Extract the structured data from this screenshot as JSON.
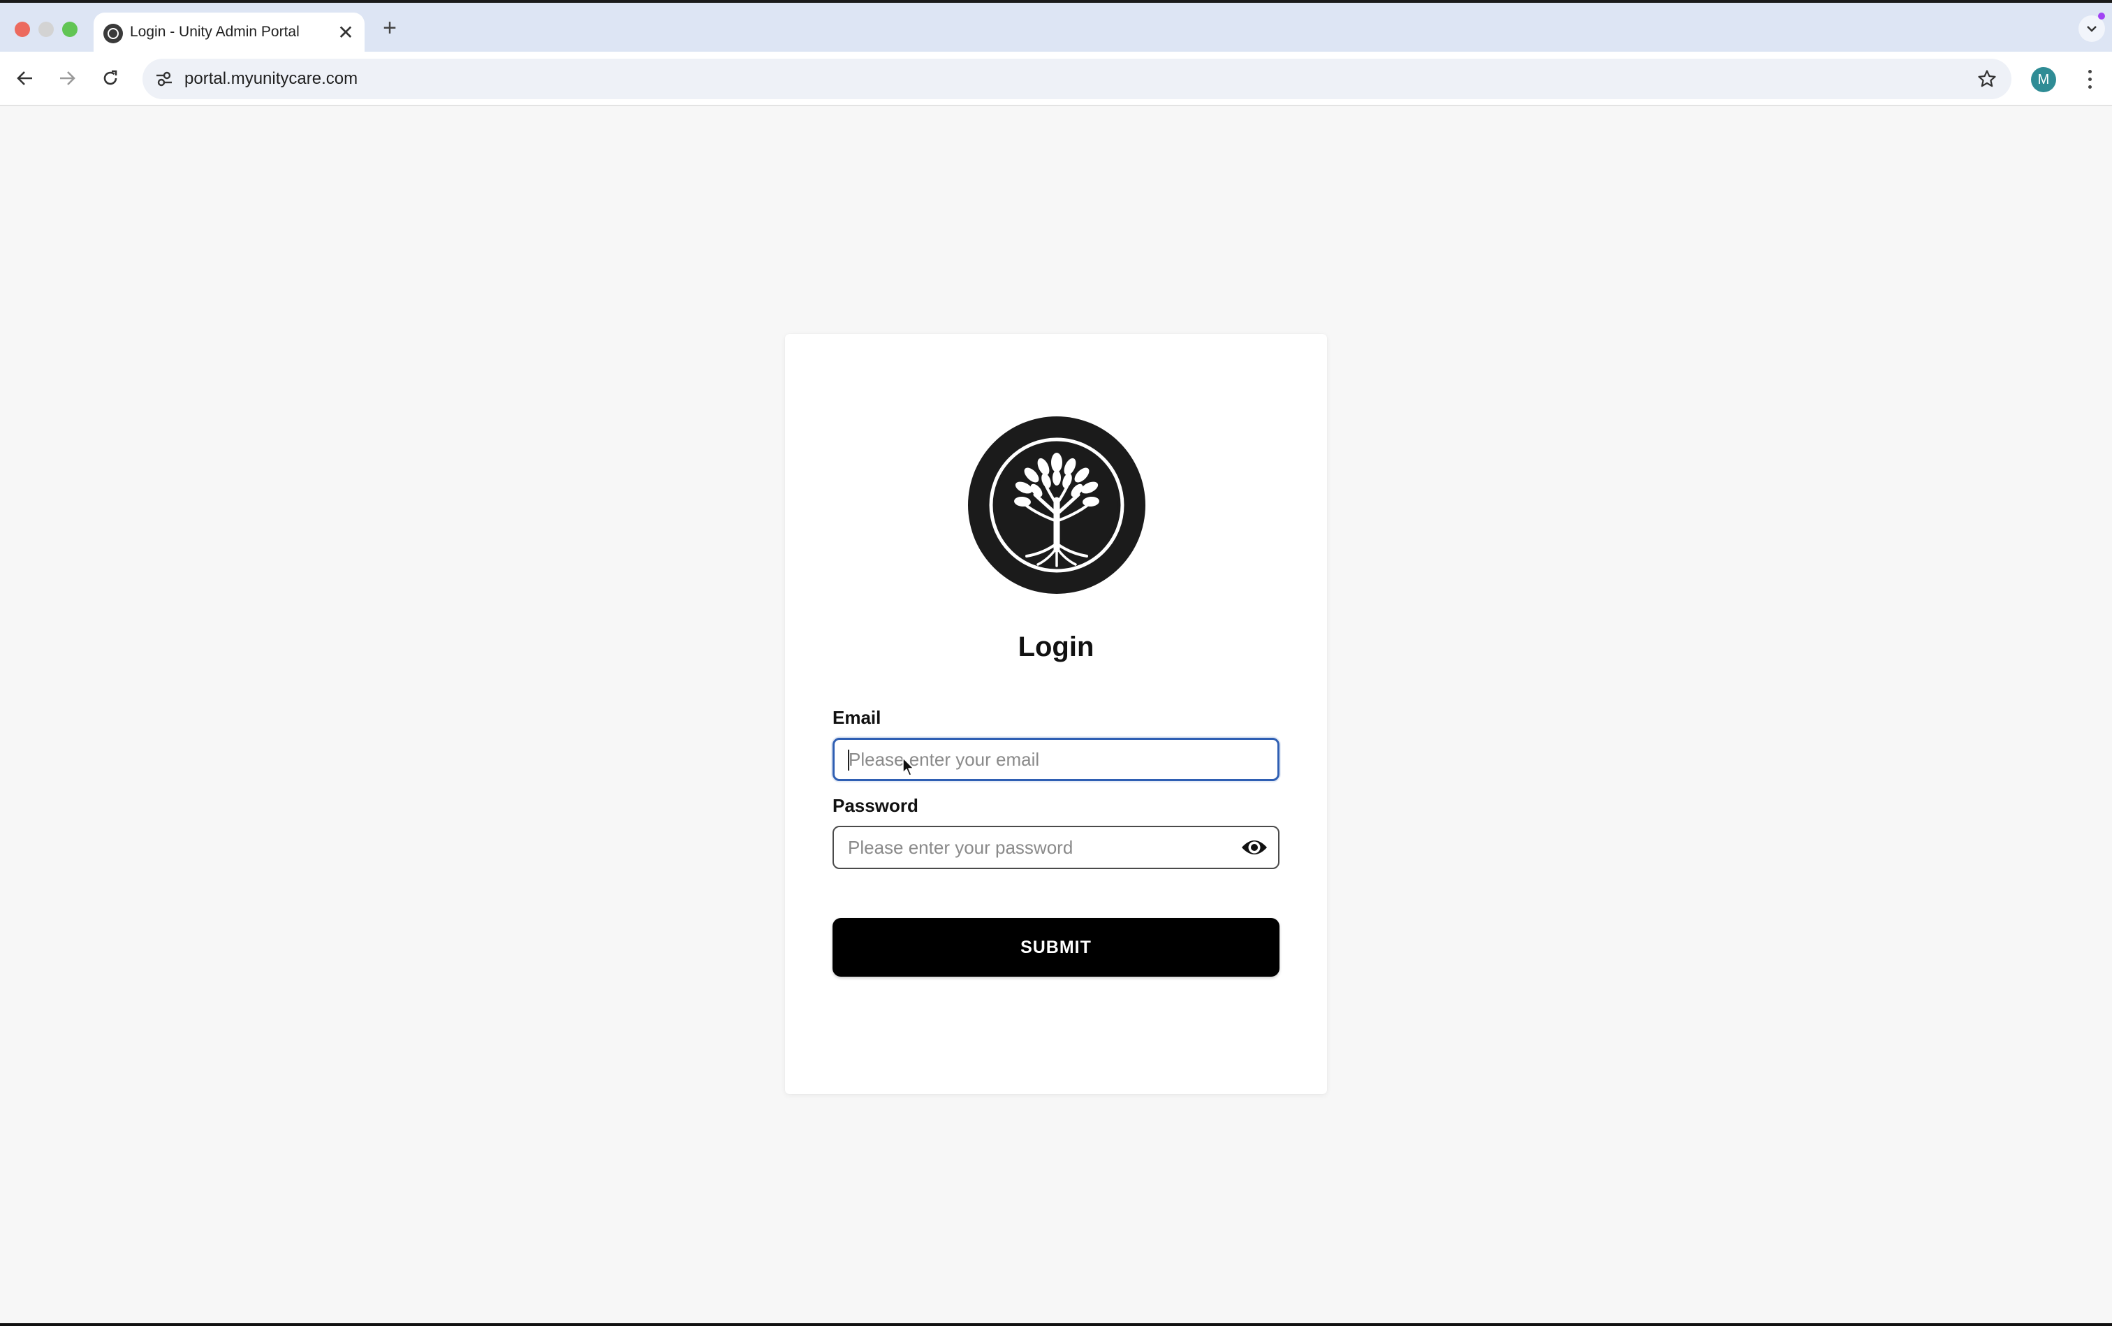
{
  "browser": {
    "tab": {
      "title": "Login - Unity Admin Portal",
      "favicon": "tree-favicon-icon",
      "close_glyph": "✕"
    },
    "new_tab_glyph": "+",
    "url": "portal.myunitycare.com",
    "profile_initial": "M",
    "profile_color": "#2f8c95"
  },
  "login": {
    "heading": "Login",
    "email": {
      "label": "Email",
      "placeholder": "Please enter your email",
      "value": ""
    },
    "password": {
      "label": "Password",
      "placeholder": "Please enter your password",
      "value": ""
    },
    "submit_label": "SUBMIT"
  },
  "icons": {
    "logo": "tree-of-life-logo",
    "password_toggle": "eye-icon"
  },
  "colors": {
    "page_background": "#f7f7f7",
    "focus_border": "#2f5fb3",
    "button_background": "#000000",
    "tabstrip_background": "#dde5f4"
  }
}
